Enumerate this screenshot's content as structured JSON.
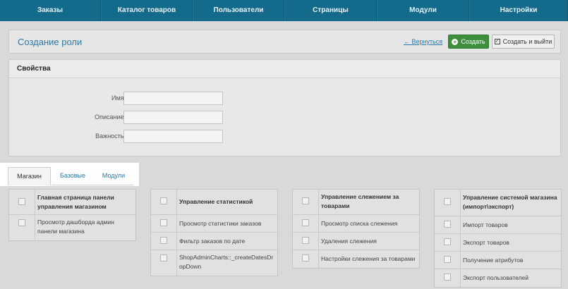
{
  "nav": {
    "items": [
      "Заказы",
      "Каталог товаров",
      "Пользователи",
      "Страницы",
      "Модули",
      "Настройки"
    ]
  },
  "header": {
    "title": "Создание роли",
    "back_link": "← Вернуться",
    "create_label": "Создать",
    "create_exit_label": "Создать и выйти"
  },
  "properties": {
    "heading": "Свойства",
    "fields": {
      "name_label": "Имя:",
      "name_value": "",
      "description_label": "Описание:",
      "description_value": "",
      "importance_label": "Важность:",
      "importance_value": ""
    }
  },
  "tabs": [
    "Магазин",
    "Базовые",
    "Модули"
  ],
  "permission_groups": [
    {
      "title": "Главная страница панели управления магазином",
      "items": [
        "Просмотр дашборда админ панели магазина"
      ]
    },
    {
      "title": "Управление статистикой",
      "items": [
        "Просмотр статистики заказов",
        "Фильтр заказов по дате",
        "ShopAdminCharts::_createDatesDropDown"
      ]
    },
    {
      "title": "Управление слежением за товарами",
      "items": [
        "Просмотр списка слежения",
        "Удаления слежения",
        "Настройки слежения за товарами"
      ]
    },
    {
      "title": "Управление системой магазина (импорт\\экспорт)",
      "items": [
        "Импорт товаров",
        "Экспорт товаров",
        "Получение атрибутов",
        "Экспорт пользователей"
      ]
    }
  ],
  "colors": {
    "nav_bg": "#136a8a",
    "accent_link": "#2a78a8",
    "create_button": "#3d8f3d"
  }
}
